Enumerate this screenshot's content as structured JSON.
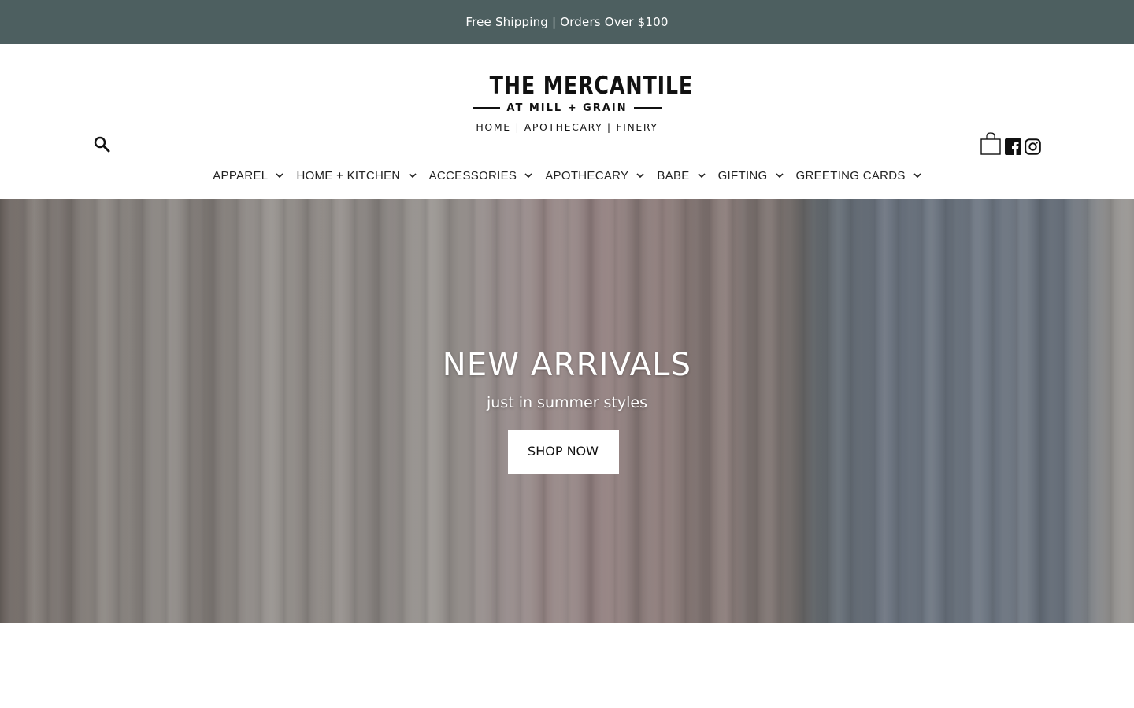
{
  "announcement": {
    "text": "Free Shipping | Orders Over $100"
  },
  "colors": {
    "announcement_bg": "#4d5f60",
    "text": "#222222",
    "hero_button_bg": "#ffffff"
  },
  "logo": {
    "title": "THE MERCANTILE",
    "subtitle": "AT MILL + GRAIN",
    "tagline": "HOME | APOTHECARY | FINERY"
  },
  "icons": {
    "search": "search-icon",
    "cart": "shopping-bag-icon",
    "facebook": "facebook-icon",
    "instagram": "instagram-icon",
    "chevron": "chevron-down-icon"
  },
  "nav": {
    "items": [
      {
        "label": "APPAREL"
      },
      {
        "label": "HOME + KITCHEN"
      },
      {
        "label": "ACCESSORIES"
      },
      {
        "label": "APOTHECARY"
      },
      {
        "label": "BABE"
      },
      {
        "label": "GIFTING"
      },
      {
        "label": "GREETING CARDS"
      }
    ]
  },
  "hero": {
    "title": "NEW ARRIVALS",
    "subtitle": "just in summer styles",
    "button_label": "SHOP NOW"
  }
}
